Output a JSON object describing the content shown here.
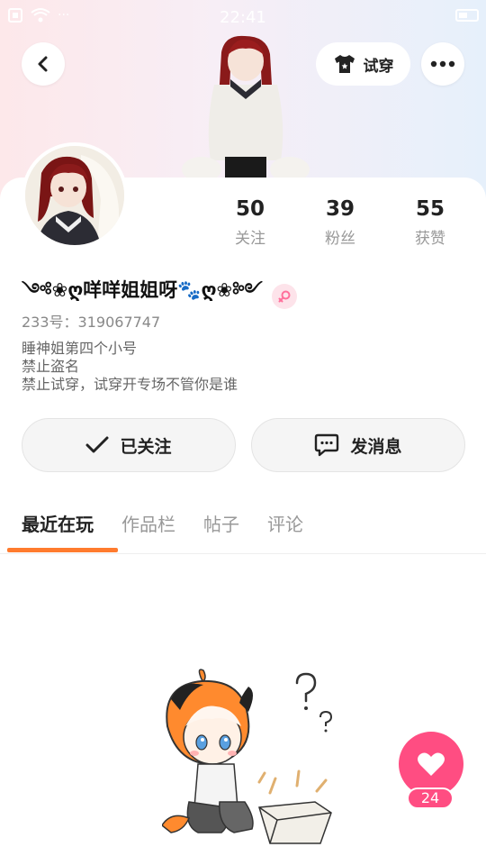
{
  "status_bar": {
    "time": "22:41"
  },
  "header": {
    "tryon_label": "试穿"
  },
  "profile": {
    "nickname": "༺❀ღ咩咩姐姐呀🐾ღ❀༻",
    "uid": "233号：319067747",
    "bio": [
      "睡神姐第四个小号",
      "禁止盗名",
      "禁止试穿，试穿开专场不管你是谁"
    ]
  },
  "stats": [
    {
      "value": "50",
      "label": "关注"
    },
    {
      "value": "39",
      "label": "粉丝"
    },
    {
      "value": "55",
      "label": "获赞"
    }
  ],
  "actions": {
    "follow_label": "已关注",
    "message_label": "发消息"
  },
  "tabs": [
    {
      "label": "最近在玩",
      "active": true
    },
    {
      "label": "作品栏"
    },
    {
      "label": "帖子"
    },
    {
      "label": "评论"
    }
  ],
  "like": {
    "count": "24"
  },
  "colors": {
    "accent": "#ff7b2e",
    "like": "#ff4d82",
    "gender_bg": "#fde3ea"
  },
  "icons": [
    "back-arrow-icon",
    "tshirt-icon",
    "more-dots-icon",
    "checkmark-icon",
    "chat-bubble-icon",
    "heart-icon",
    "female-icon"
  ]
}
